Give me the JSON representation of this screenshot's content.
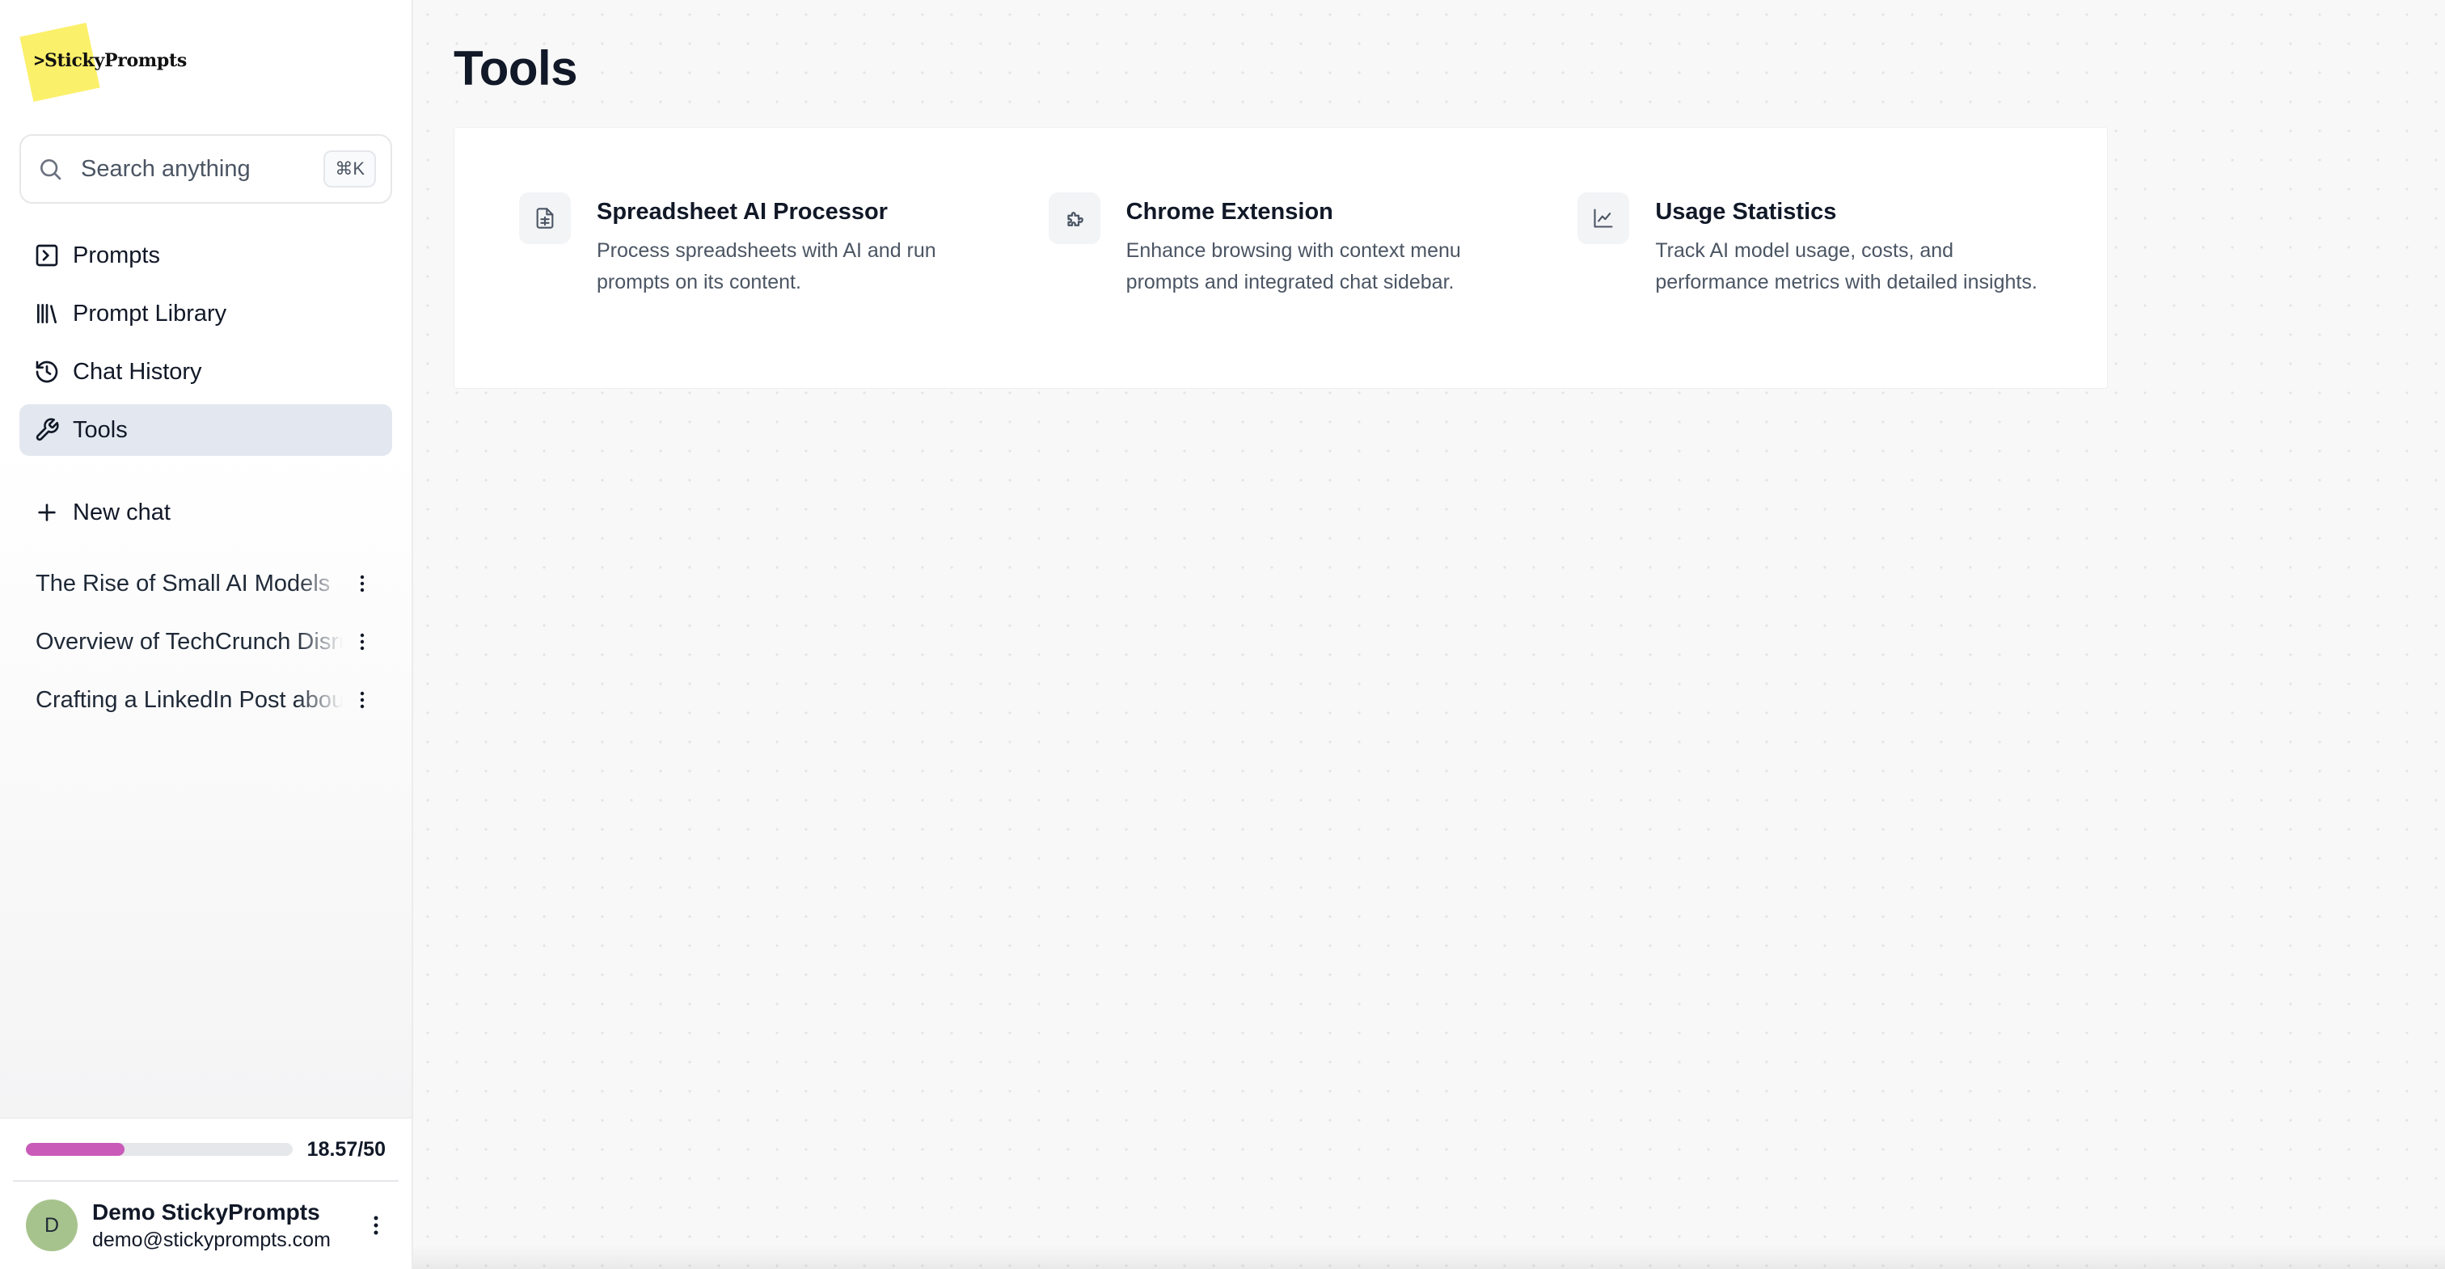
{
  "brand": {
    "name": "StickyPrompts",
    "chevron": ">",
    "note_color": "#fbf06a"
  },
  "search": {
    "label": "Search anything",
    "shortcut": "⌘K"
  },
  "nav": [
    {
      "label": "Prompts",
      "icon": "prompt-square-icon",
      "active": false
    },
    {
      "label": "Prompt Library",
      "icon": "library-icon",
      "active": false
    },
    {
      "label": "Chat History",
      "icon": "history-icon",
      "active": false
    },
    {
      "label": "Tools",
      "icon": "wrench-icon",
      "active": true
    }
  ],
  "new_chat": {
    "label": "New chat"
  },
  "chats": [
    {
      "title": "The Rise of Small AI Models"
    },
    {
      "title": "Overview of TechCrunch Disrupt"
    },
    {
      "title": "Crafting a LinkedIn Post about"
    }
  ],
  "usage": {
    "text": "18.57/50",
    "fraction": 0.3714,
    "color": "#c95ab8"
  },
  "user": {
    "initial": "D",
    "name": "Demo StickyPrompts",
    "email": "demo@stickyprompts.com"
  },
  "page": {
    "title": "Tools"
  },
  "tools": [
    {
      "name": "Spreadsheet AI Processor",
      "description": "Process spreadsheets with AI and run prompts on its content.",
      "icon": "spreadsheet-icon"
    },
    {
      "name": "Chrome Extension",
      "description": "Enhance browsing with context menu prompts and integrated chat sidebar.",
      "icon": "puzzle-icon"
    },
    {
      "name": "Usage Statistics",
      "description": "Track AI model usage, costs, and performance metrics with detailed insights.",
      "icon": "line-chart-icon"
    }
  ]
}
